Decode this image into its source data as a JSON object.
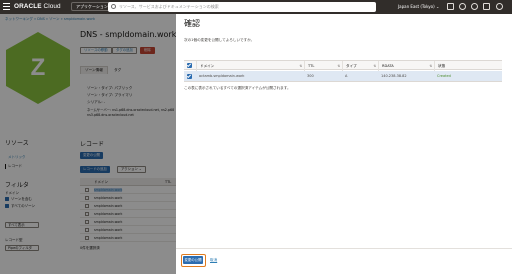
{
  "header": {
    "logo_brand": "ORACLE",
    "logo_product": "Cloud",
    "apps_label": "アプリケーション",
    "search_placeholder": "リソース、サービスおよびドキュメンテーションの検索",
    "region": "Japan East (Tokyo)",
    "region_caret": "⌄"
  },
  "background": {
    "breadcrumb": "ネットワーキング » DNS » ゾーン » smpldomain.work",
    "zone_letter": "Z",
    "page_title": "DNS - smpldomain.work",
    "action_buttons": [
      "リソースの移動",
      "タグの追加",
      "削除"
    ],
    "tabs": [
      "ゾーン情報",
      "タグ"
    ],
    "info_lines": [
      "ゾーン・タイプ: パブリック",
      "ゾーン・タイプ: プライマリ",
      "シリアル: -",
      "ネームサーバー: ns1.p68.dns.oraclecloud.net, ns2.p68",
      "ns3.p68.dns.oraclecloud.net"
    ],
    "resources_title": "リソース",
    "resource_links": [
      "メトリック",
      "レコード"
    ],
    "filter_title": "フィルタ",
    "filter_label_1": "ドメイン",
    "filter_checks": [
      "ゾーンを含む",
      "すべてのゾーン"
    ],
    "filter_select_1": "すべて表示",
    "filter_label_2": "レコード型",
    "filter_select_2": "Pipeのフィルタ",
    "records_title": "レコード",
    "records_btn_publish": "変更の公開",
    "records_btn_add": "レコードの追加",
    "records_btn_action": "アクション ⌄",
    "records_table_headers": [
      "ドメイン",
      "TTL"
    ],
    "records_rows": [
      "smpldomain.work",
      "smpldomain.work",
      "smpldomain.work",
      "smpldomain.work",
      "smpldomain.work",
      "smpldomain.work",
      "smpldomain.work"
    ],
    "selection_note": "0件を選択済"
  },
  "dialog": {
    "title": "確認",
    "subtitle": "次の1個の変更を公開してよろしいですか。",
    "columns": [
      "ドメイン",
      "TTL",
      "タイプ",
      "RDATA",
      "状態"
    ],
    "sort_indicator": "⇅",
    "row": {
      "domain": "octamb.smpldomain.work",
      "ttl": "300",
      "type": "A",
      "rdata": "140.238.38.82",
      "status": "Created"
    },
    "footnote": "この表に表示されているすべての選択済アイテムが公開されます。",
    "publish_button": "変更の公開",
    "cancel_link": "取消"
  }
}
